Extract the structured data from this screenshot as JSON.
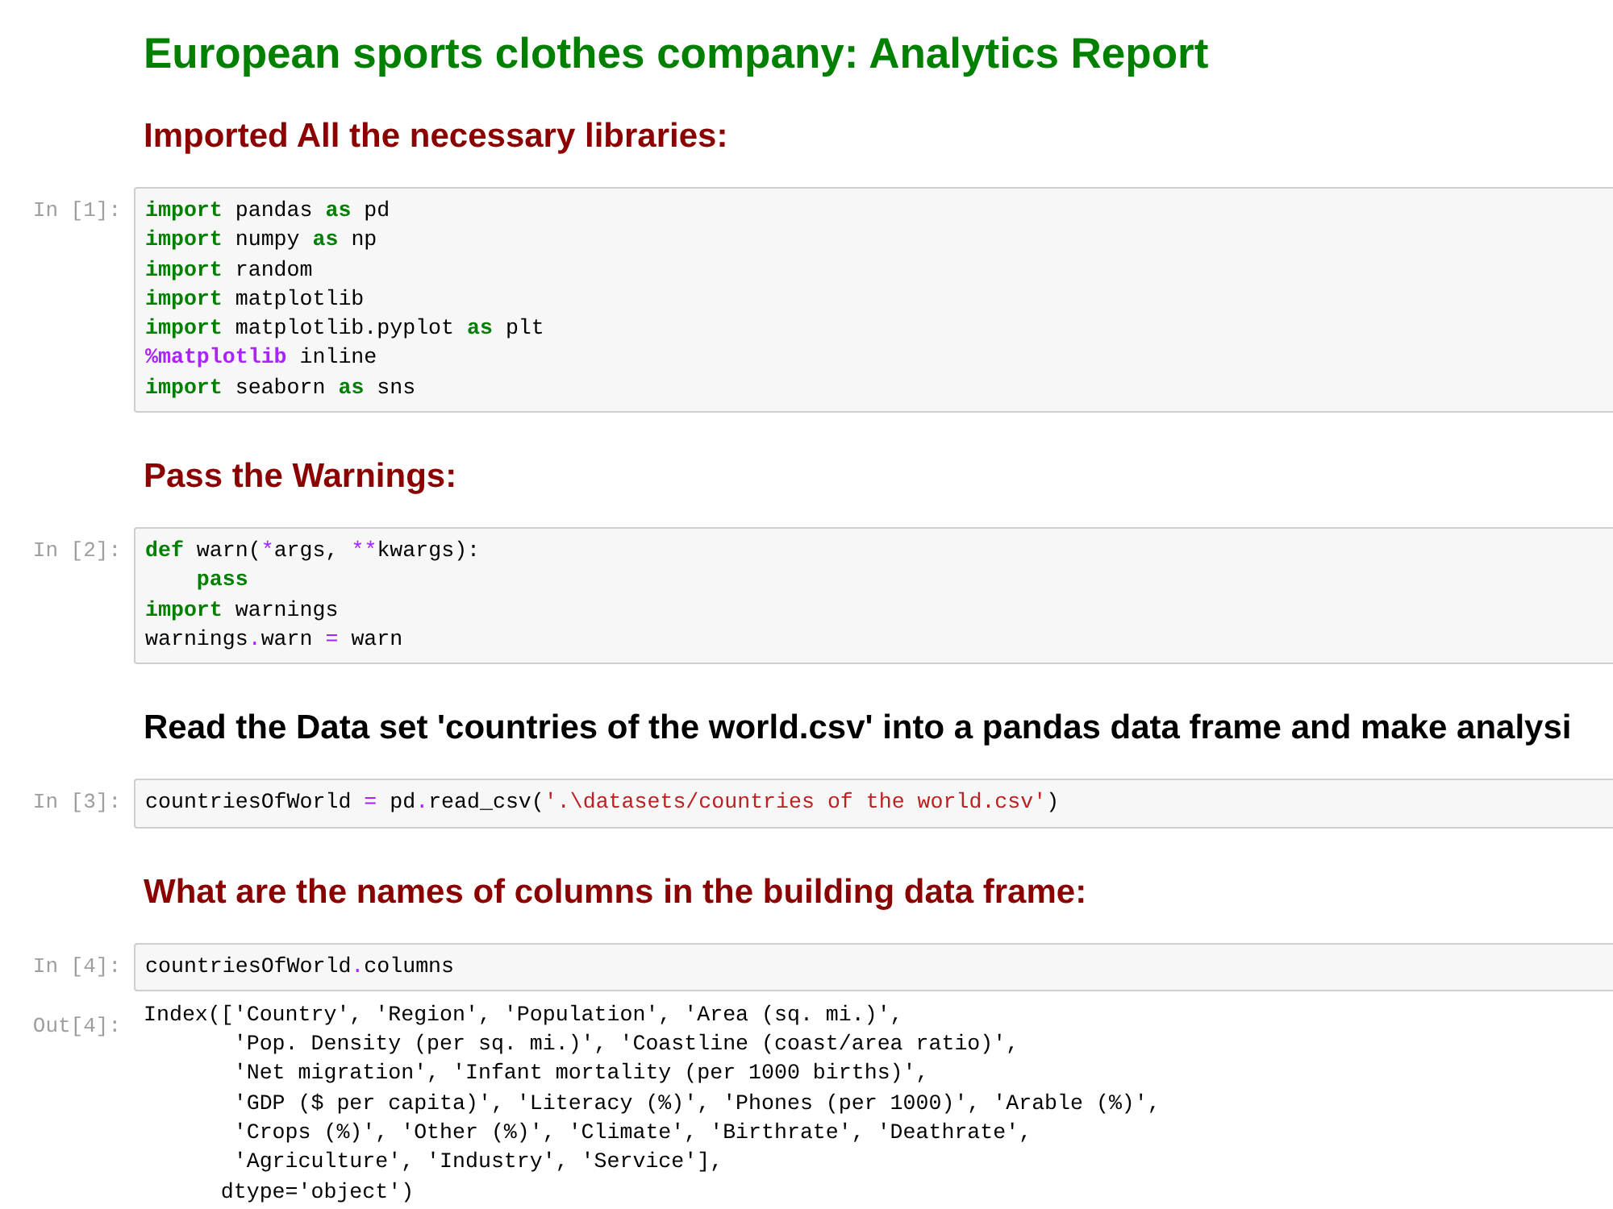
{
  "cells": [
    {
      "kind": "title",
      "color": "#008000",
      "text": "European sports clothes company: Analytics Report"
    },
    {
      "kind": "heading",
      "color": "#8b0000",
      "text": "Imported All the necessary libraries:"
    },
    {
      "kind": "code",
      "prompt": "In [1]:",
      "lines": [
        {
          "indented": false,
          "tokens": [
            {
              "kind": "keyword",
              "text": "import"
            },
            {
              "kind": "plain",
              "text": " pandas "
            },
            {
              "kind": "keyword",
              "text": "as"
            },
            {
              "kind": "plain",
              "text": " pd"
            }
          ]
        },
        {
          "indented": false,
          "tokens": [
            {
              "kind": "keyword",
              "text": "import"
            },
            {
              "kind": "plain",
              "text": " numpy "
            },
            {
              "kind": "keyword",
              "text": "as"
            },
            {
              "kind": "plain",
              "text": " np"
            }
          ]
        },
        {
          "indented": false,
          "tokens": [
            {
              "kind": "keyword",
              "text": "import"
            },
            {
              "kind": "plain",
              "text": " random"
            }
          ]
        },
        {
          "indented": false,
          "tokens": [
            {
              "kind": "keyword",
              "text": "import"
            },
            {
              "kind": "plain",
              "text": " matplotlib"
            }
          ]
        },
        {
          "indented": false,
          "tokens": [
            {
              "kind": "keyword",
              "text": "import"
            },
            {
              "kind": "plain",
              "text": " matplotlib.pyplot "
            },
            {
              "kind": "keyword",
              "text": "as"
            },
            {
              "kind": "plain",
              "text": " plt"
            }
          ]
        },
        {
          "indented": false,
          "tokens": [
            {
              "kind": "magic",
              "text": "%matplotlib"
            },
            {
              "kind": "plain",
              "text": " inline"
            }
          ]
        },
        {
          "indented": false,
          "tokens": [
            {
              "kind": "keyword",
              "text": "import"
            },
            {
              "kind": "plain",
              "text": " seaborn "
            },
            {
              "kind": "keyword",
              "text": "as"
            },
            {
              "kind": "plain",
              "text": " sns"
            }
          ]
        }
      ]
    },
    {
      "kind": "heading",
      "color": "#8b0000",
      "text": "Pass the Warnings:"
    },
    {
      "kind": "code",
      "prompt": "In [2]:",
      "lines": [
        {
          "indented": false,
          "tokens": [
            {
              "kind": "keyword",
              "text": "def"
            },
            {
              "kind": "plain",
              "text": " warn("
            },
            {
              "kind": "operator",
              "text": "*"
            },
            {
              "kind": "plain",
              "text": "args, "
            },
            {
              "kind": "operator",
              "text": "**"
            },
            {
              "kind": "plain",
              "text": "kwargs):"
            }
          ]
        },
        {
          "indented": true,
          "tokens": [
            {
              "kind": "keyword",
              "text": "pass"
            }
          ]
        },
        {
          "indented": false,
          "tokens": [
            {
              "kind": "keyword",
              "text": "import"
            },
            {
              "kind": "plain",
              "text": " warnings"
            }
          ]
        },
        {
          "indented": false,
          "tokens": [
            {
              "kind": "plain",
              "text": "warnings"
            },
            {
              "kind": "operator",
              "text": "."
            },
            {
              "kind": "plain",
              "text": "warn "
            },
            {
              "kind": "operator",
              "text": "="
            },
            {
              "kind": "plain",
              "text": " warn"
            }
          ]
        }
      ]
    },
    {
      "kind": "heading",
      "color": "#000000",
      "text": "Read the Data set 'countries of the world.csv' into a pandas data frame and make analysi"
    },
    {
      "kind": "code",
      "prompt": "In [3]:",
      "lines": [
        {
          "indented": false,
          "tokens": [
            {
              "kind": "plain",
              "text": "countriesOfWorld "
            },
            {
              "kind": "operator",
              "text": "="
            },
            {
              "kind": "plain",
              "text": " pd"
            },
            {
              "kind": "operator",
              "text": "."
            },
            {
              "kind": "plain",
              "text": "read_csv("
            },
            {
              "kind": "string",
              "text": "'.\\datasets/countries of the world.csv'"
            },
            {
              "kind": "plain",
              "text": ")"
            }
          ]
        }
      ]
    },
    {
      "kind": "heading",
      "color": "#8b0000",
      "text": "What are the names of columns in the building data frame:"
    },
    {
      "kind": "code",
      "prompt": "In [4]:",
      "lines": [
        {
          "indented": false,
          "tokens": [
            {
              "kind": "plain",
              "text": "countriesOfWorld"
            },
            {
              "kind": "operator",
              "text": "."
            },
            {
              "kind": "plain",
              "text": "columns"
            }
          ]
        }
      ],
      "output": {
        "prompt": "Out[4]:",
        "lines": [
          "Index(['Country', 'Region', 'Population', 'Area (sq. mi.)',",
          "       'Pop. Density (per sq. mi.)', 'Coastline (coast/area ratio)',",
          "       'Net migration', 'Infant mortality (per 1000 births)',",
          "       'GDP ($ per capita)', 'Literacy (%)', 'Phones (per 1000)', 'Arable (%)',",
          "       'Crops (%)', 'Other (%)', 'Climate', 'Birthrate', 'Deathrate',",
          "       'Agriculture', 'Industry', 'Service'],",
          "      dtype='object')"
        ]
      }
    }
  ]
}
